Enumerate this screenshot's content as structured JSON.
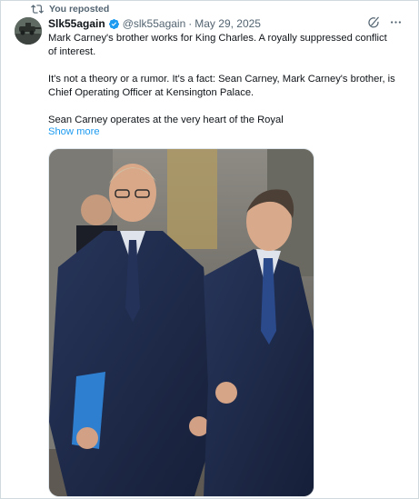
{
  "repost": {
    "label": "You reposted",
    "icon": "repost-icon"
  },
  "post": {
    "author_name": "Slk55again",
    "verified": true,
    "handle": "@slk55again",
    "separator": "·",
    "date": "May 29, 2025",
    "paragraphs": [
      "Mark Carney's brother works for King Charles. A royally suppressed conflict of interest.",
      "It's not a theory or a rumor. It's a fact: Sean Carney, Mark Carney's brother, is Chief Operating Officer at Kensington Palace.",
      "Sean Carney operates at the very heart of the Royal"
    ],
    "show_more": "Show more",
    "actions": {
      "grok_icon": "grok-icon",
      "more_icon": "more-icon"
    }
  },
  "colors": {
    "link": "#1d9bf0",
    "secondary_text": "#536471",
    "verified": "#1d9bf0"
  }
}
